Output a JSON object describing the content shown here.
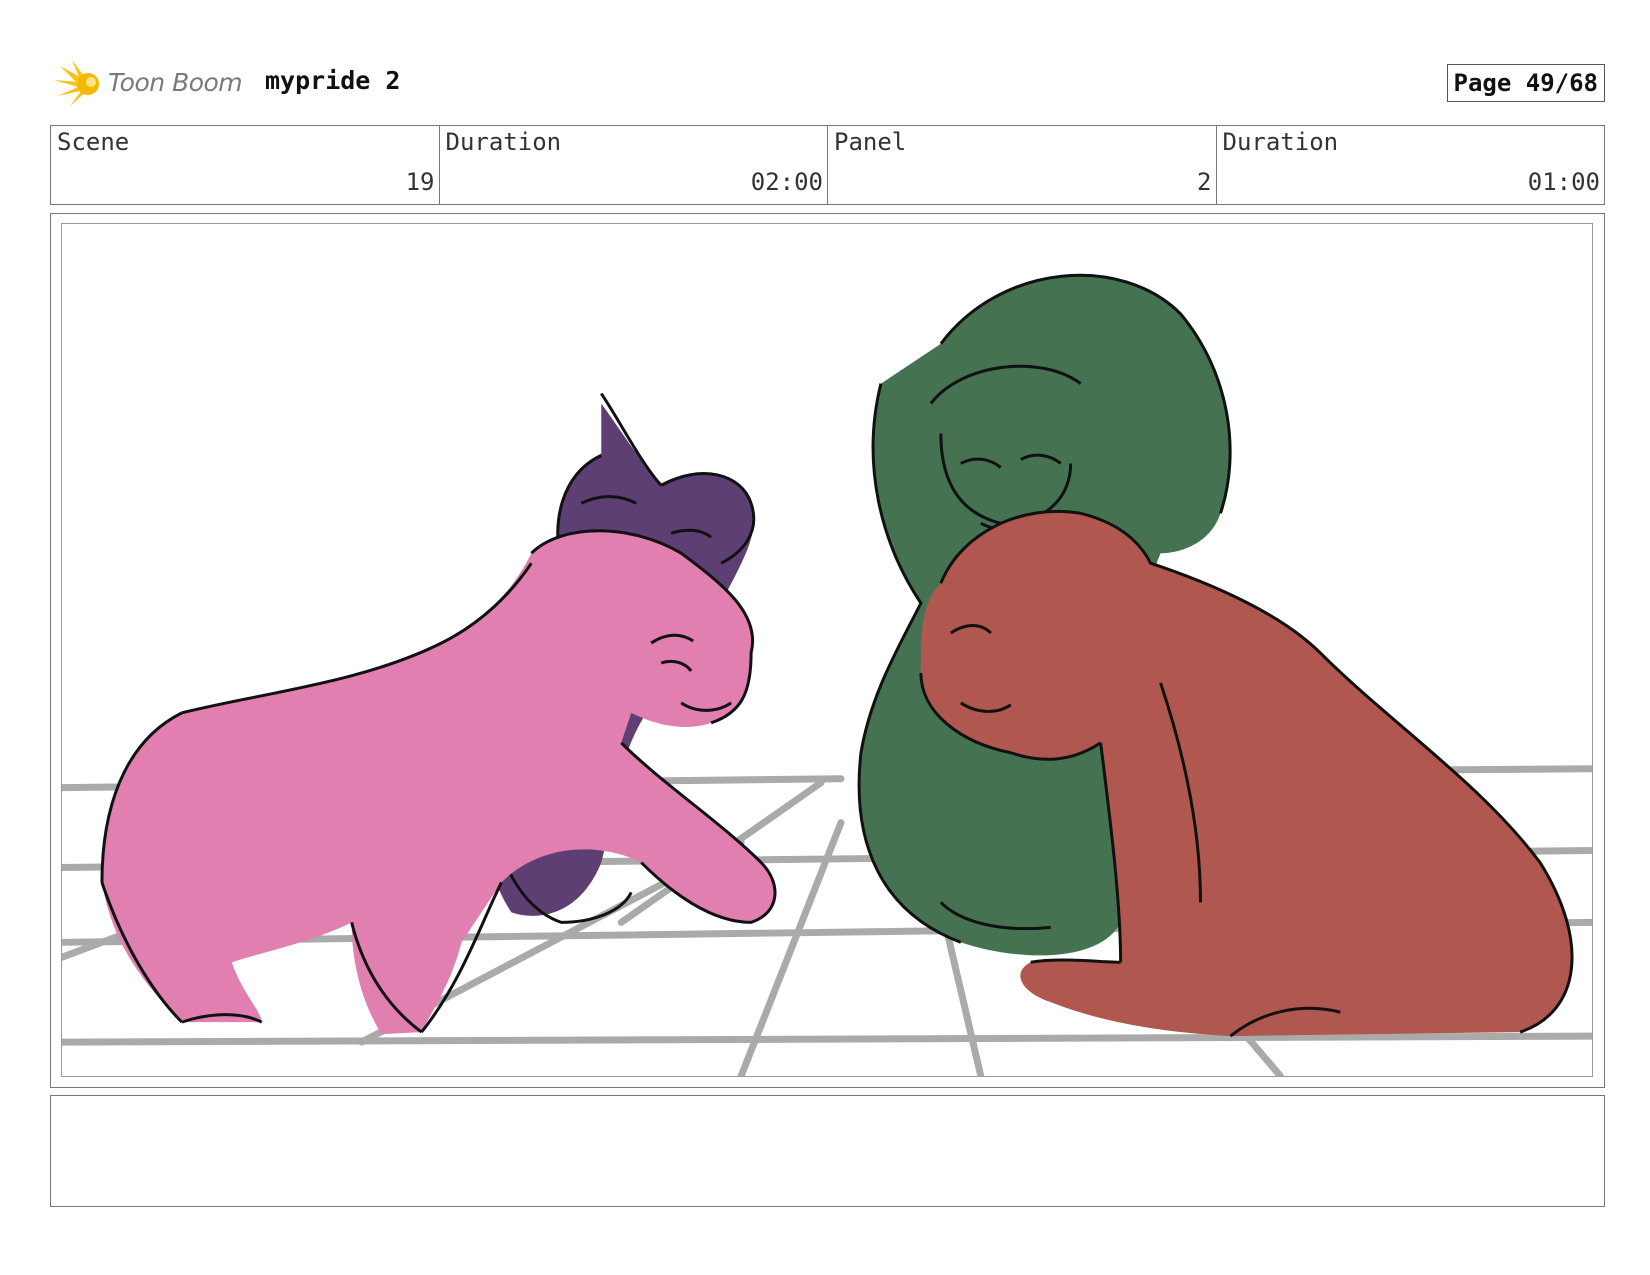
{
  "header": {
    "logo_text": "Toon Boom",
    "project_title": "mypride 2",
    "page_label": "Page 49/68"
  },
  "info": [
    {
      "label": "Scene",
      "value": "19"
    },
    {
      "label": "Duration",
      "value": "02:00"
    },
    {
      "label": "Panel",
      "value": "2"
    },
    {
      "label": "Duration",
      "value": "01:00"
    }
  ],
  "colors": {
    "pink_lion": "#e07fb0",
    "purple_lion": "#5e3f74",
    "green_lion": "#457352",
    "red_lion": "#b0574f",
    "floor_grid": "#aaaaaa",
    "logo_yellow": "#f5c518"
  },
  "icons": {
    "logo": "toon-boom-sun-icon"
  },
  "notes": ""
}
